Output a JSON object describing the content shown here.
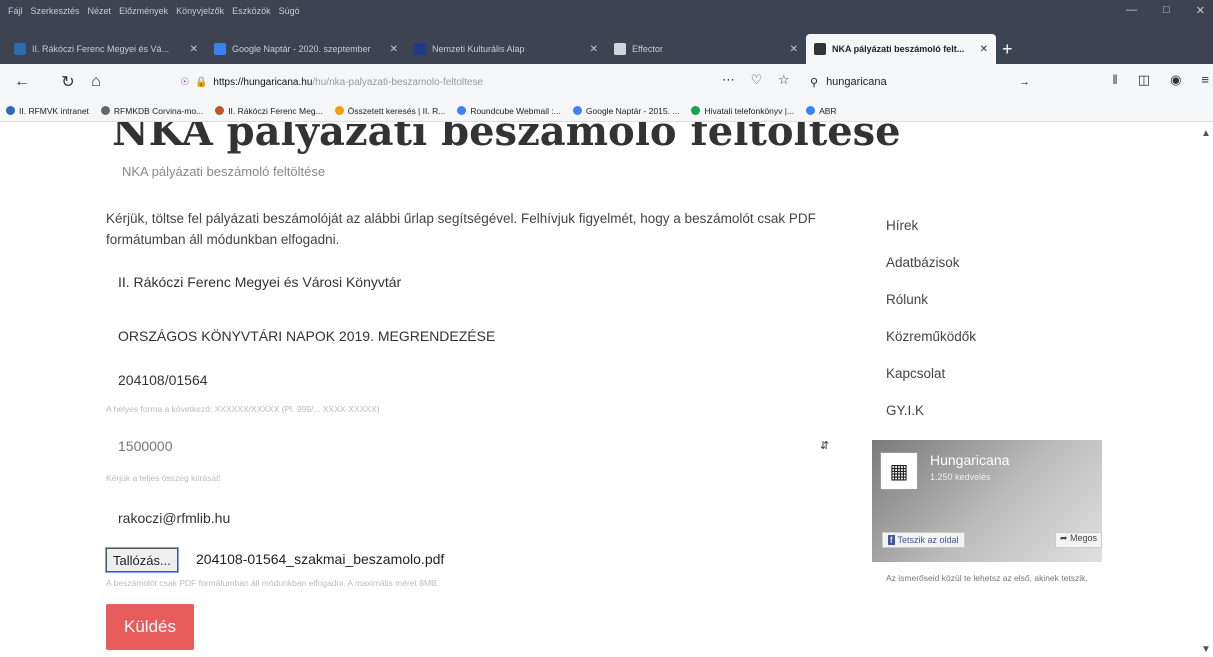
{
  "browser": {
    "menu": [
      "Fájl",
      "Szerkesztés",
      "Nézet",
      "Előzmények",
      "Könyvjelzők",
      "Eszközök",
      "Súgó"
    ],
    "tabs": [
      {
        "title": "II. Rákóczi Ferenc Megyei és Vá...",
        "favicon_color": "#2b6cb0"
      },
      {
        "title": "Google Naptár - 2020. szeptember",
        "favicon_color": "#3b82f6"
      },
      {
        "title": "Nemzeti Kulturális Alap",
        "favicon_color": "#1e3a8a"
      },
      {
        "title": "Effector",
        "favicon_color": "#d1d5db"
      },
      {
        "title": "NKA pályázati beszámoló felt...",
        "favicon_color": "#333333",
        "active": true
      }
    ],
    "new_tab": "+",
    "url_host": "https://hungaricana.hu",
    "url_path": "/hu/nka-palyazati-beszamolo-feltoltese",
    "search_value": "hungaricana",
    "bookmarks": [
      {
        "label": "II. RFMVK intranet",
        "color": "#2b6cb0"
      },
      {
        "label": "RFMKDB Corvina-mo...",
        "color": "#666666"
      },
      {
        "label": "II. Rákóczi Ferenc Meg...",
        "color": "#c05621"
      },
      {
        "label": "Összetett keresés | II. R...",
        "color": "#f59e0b"
      },
      {
        "label": "Roundcube Webmail :...",
        "color": "#3b82f6"
      },
      {
        "label": "Google Naptár - 2015. ...",
        "color": "#3b82f6"
      },
      {
        "label": "Hivatali telefonkönyv |...",
        "color": "#16a34a"
      },
      {
        "label": "ABR",
        "color": "#3b82f6"
      }
    ]
  },
  "page": {
    "title": "NKA pályázati beszámoló feltöltése",
    "breadcrumb": "NKA pályázati beszámoló feltöltése",
    "intro": "Kérjük, töltse fel pályázati beszámolóját az alábbi űrlap segítségével. Felhívjuk figyelmét, hogy a beszámolót csak PDF formátumban áll módunkban elfogadni.",
    "fields": {
      "institution": "II. Rákóczi Ferenc Megyei és Városi Könyvtár",
      "project": "ORSZÁGOS KÖNYVTÁRI NAPOK 2019. MEGRENDEZÉSE",
      "id_number": "204108/01564",
      "id_help": "A helyes forma a következő: XXXXXX/XXXXX (Pl. 999/... XXXX-XXXXX)",
      "amount": "1500000",
      "amount_help": "Kérjük a teljes összeg kiírását!",
      "email": "rakoczi@rfmlib.hu",
      "browse_label": "Tallózás...",
      "file_name": "204108-01564_szakmai_beszamolo.pdf",
      "file_help": "A beszámolót csak PDF formátumban áll módunkban elfogadni. A maximális méret 8MB.",
      "submit_label": "Küldés"
    },
    "sidebar_nav": [
      "Hírek",
      "Adatbázisok",
      "Rólunk",
      "Közreműködők",
      "Kapcsolat",
      "GY.I.K"
    ],
    "facebook": {
      "name": "Hungaricana",
      "likes": "1.250 kedvelés",
      "like_label": "Tetszik az oldal",
      "share_label": "Megos",
      "note": "Az ismerőseid közül te lehetsz az első, akinek tetszik."
    }
  }
}
